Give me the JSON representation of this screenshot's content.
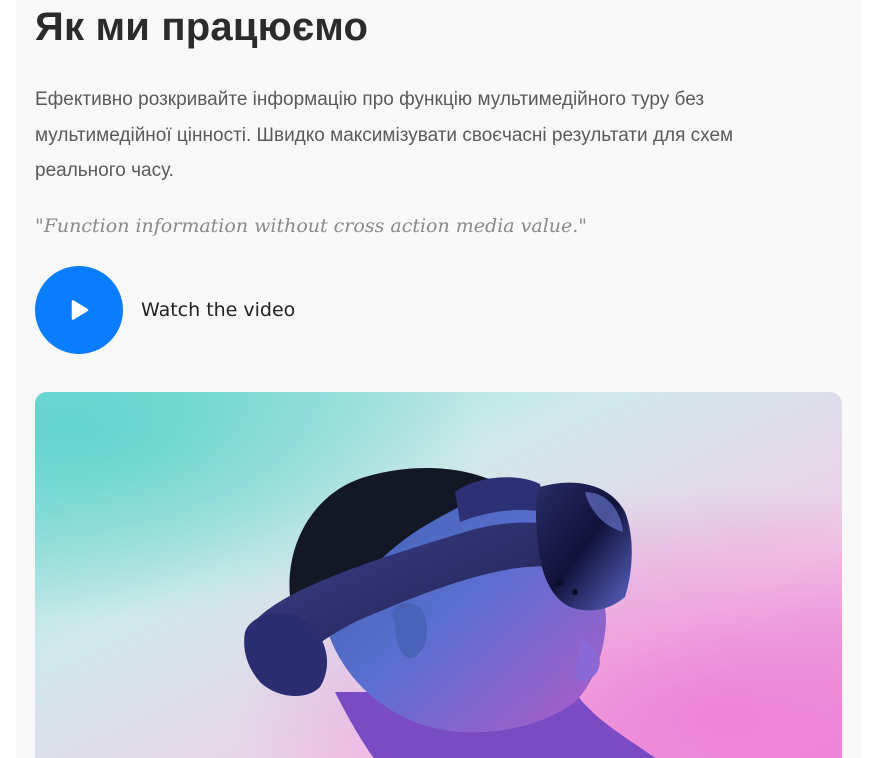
{
  "section": {
    "title": "Як ми працюємо",
    "description": "Ефективно розкривайте інформацію про функцію мультимедійного туру без мультимедійної цінності. Швидко максимізувати своєчасні результати для схем реального часу.",
    "quote": "\"Function information without cross action media value.\"",
    "video_label": "Watch the video"
  },
  "icons": {
    "play": "play-icon"
  },
  "colors": {
    "accent": "#0a7cff",
    "heading": "#2b2b2b",
    "body_text": "#5a5a5a",
    "quote_text": "#8a8a8a",
    "card_background": "#f8f8f8"
  }
}
